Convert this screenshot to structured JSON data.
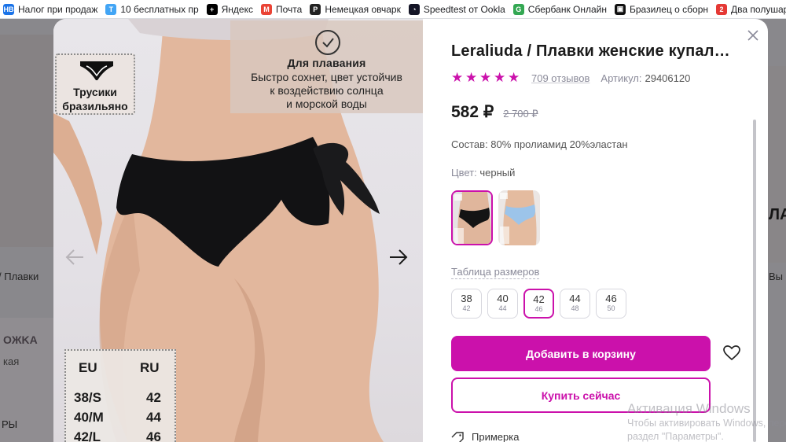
{
  "bookmarks": [
    {
      "label": "Налог при продаж",
      "icon": "nalog-icon",
      "color": "#1a73e8",
      "glyph": "НВ"
    },
    {
      "label": "10 бесплатных пр",
      "icon": "fb-like-icon",
      "color": "#42a5f5",
      "glyph": "T"
    },
    {
      "label": "Яндекс",
      "icon": "yandex-plus-icon",
      "color": "#000000",
      "glyph": "+"
    },
    {
      "label": "Почта",
      "icon": "gmail-icon",
      "color": "#ea4335",
      "glyph": "M"
    },
    {
      "label": "Немецкая овчарк",
      "icon": "p-letter-icon",
      "color": "#222222",
      "glyph": "P"
    },
    {
      "label": "Speedtest от Ookla",
      "icon": "speedtest-icon",
      "color": "#141526",
      "glyph": "◔"
    },
    {
      "label": "Сбербанк Онлайн",
      "icon": "google-icon",
      "color": "#34a853",
      "glyph": "G"
    },
    {
      "label": "Бразилец о сборн",
      "icon": "sports-icon",
      "color": "#111111",
      "glyph": "▣"
    },
    {
      "label": "Два полушар",
      "icon": "two-hemispheres-icon",
      "color": "#e53935",
      "glyph": "2"
    }
  ],
  "background": {
    "breadcrumb_left": "/ Плавки",
    "side_label_left": "OЖKA",
    "side_label_left2": "кая",
    "side_label_left3": "РЫ",
    "side_label_right": "ЛА",
    "side_label_right2": "Вы"
  },
  "photo": {
    "badge_left_text": "Трусики\nбразильяно",
    "badge_right_title": "Для плавания",
    "badge_right_desc": "Быстро сохнет, цвет устойчив\nк воздействию солнца\nи морской воды",
    "size_chart": {
      "headers": [
        "EU",
        "RU"
      ],
      "rows": [
        [
          "38/S",
          "42"
        ],
        [
          "40/M",
          "44"
        ],
        [
          "42/L",
          "46"
        ]
      ]
    },
    "prev_icon": "arrow-left-icon",
    "next_icon": "arrow-right-icon"
  },
  "product": {
    "title": "Leraliuda / Плавки женские купальные",
    "rating_stars": 5,
    "reviews": "709 отзывов",
    "article_label": "Артикул:",
    "article_value": "29406120",
    "price": "582 ₽",
    "old_price": "2 700 ₽",
    "composition": "Состав: 80% пролиамид 20%эластан",
    "color_label": "Цвет:",
    "color_value": "черный",
    "color_options": [
      {
        "name": "black",
        "selected": true
      },
      {
        "name": "light-blue",
        "selected": false
      }
    ],
    "size_table_label": "Таблица размеров",
    "sizes": [
      {
        "eu": "38",
        "ru": "42",
        "selected": false
      },
      {
        "eu": "40",
        "ru": "44",
        "selected": false
      },
      {
        "eu": "42",
        "ru": "46",
        "selected": true
      },
      {
        "eu": "44",
        "ru": "48",
        "selected": false
      },
      {
        "eu": "46",
        "ru": "50",
        "selected": false
      }
    ],
    "add_to_cart": "Добавить в корзину",
    "buy_now": "Купить сейчас",
    "fitting": "Примерка"
  },
  "colors": {
    "accent": "#cb11ab",
    "star": "#cb11ab",
    "muted": "#8a8a99"
  },
  "watermark": {
    "line1": "Активация Windows",
    "line2": "Чтобы активировать Windows, перейдите в",
    "line3": "раздел \"Параметры\"."
  }
}
